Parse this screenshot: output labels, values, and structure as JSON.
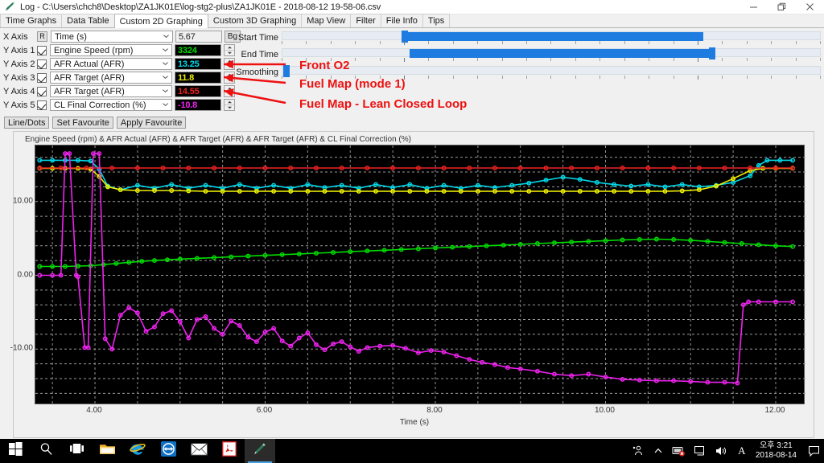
{
  "window": {
    "title": "Log - C:\\Users\\chch8\\Desktop\\ZA1JK01E\\log-stg2-plus\\ZA1JK01E - 2018-08-12 19-58-06.csv",
    "app_icon": "pen-icon",
    "minimize_label": "—",
    "restore_label": "❐",
    "close_label": "✕"
  },
  "tabs": [
    {
      "label": "Time Graphs",
      "active": false
    },
    {
      "label": "Data Table",
      "active": false
    },
    {
      "label": "Custom 2D Graphing",
      "active": true
    },
    {
      "label": "Custom 3D Graphing",
      "active": false
    },
    {
      "label": "Map View",
      "active": false
    },
    {
      "label": "Filter",
      "active": false
    },
    {
      "label": "File Info",
      "active": false
    },
    {
      "label": "Tips",
      "active": false
    }
  ],
  "axes": [
    {
      "label": "X Axis",
      "control": "reset-button",
      "control_label": "R",
      "channel": "Time (s)",
      "value": "5.67",
      "value_color": "#1b1b1b",
      "box_style": "light",
      "extra_button": "Bg"
    },
    {
      "label": "Y Axis 1",
      "control": "checkbox",
      "checked": true,
      "channel": "Engine Speed (rpm)",
      "value": "3324",
      "value_color": "#00dd00",
      "box_style": "dark"
    },
    {
      "label": "Y Axis 2",
      "control": "checkbox",
      "checked": true,
      "channel": "AFR Actual (AFR)",
      "value": "13.25",
      "value_color": "#00d8e8",
      "box_style": "dark"
    },
    {
      "label": "Y Axis 3",
      "control": "checkbox",
      "checked": true,
      "channel": "AFR Target (AFR)",
      "value": "11.8",
      "value_color": "#eeee00",
      "box_style": "dark"
    },
    {
      "label": "Y Axis 4",
      "control": "checkbox",
      "checked": true,
      "channel": "AFR Target (AFR)",
      "value": "14.55",
      "value_color": "#ee2222",
      "box_style": "dark"
    },
    {
      "label": "Y Axis 5",
      "control": "checkbox",
      "checked": true,
      "channel": "CL Final Correction (%)",
      "value": "-10.8",
      "value_color": "#ee22ee",
      "box_style": "dark"
    }
  ],
  "buttons": {
    "line_dots": "Line/Dots",
    "set_favourite": "Set Favourite",
    "apply_favourite": "Apply Favourite"
  },
  "sliders": [
    {
      "name": "Start Time",
      "label": "Start Time",
      "fill_start_pct": 22.5,
      "fill_end_pct": 78.0,
      "thumb_pct": 22.5
    },
    {
      "name": "End Time",
      "label": "End Time",
      "fill_start_pct": 23.6,
      "fill_end_pct": 79.5,
      "thumb_pct": 79.5
    },
    {
      "name": "Smoothing",
      "label": "Smoothing",
      "fill_start_pct": 0,
      "fill_end_pct": 0,
      "thumb_pct": 0.6
    }
  ],
  "annotations": [
    {
      "text": "Front O2",
      "target": "Y Axis 2 spinner"
    },
    {
      "text": "Fuel Map (mode 1)",
      "target": "Y Axis 3 spinner"
    },
    {
      "text": "Fuel Map - Lean Closed Loop",
      "target": "Y Axis 4 spinner"
    }
  ],
  "annotation_color": "#ee1111",
  "chart_data": {
    "type": "line",
    "title": "Engine Speed (rpm) & AFR Actual (AFR) & AFR Target (AFR) & AFR Target (AFR) & CL Final Correction (%)",
    "xlabel": "Time (s)",
    "ylabel": "",
    "xlim": [
      3.3,
      12.35
    ],
    "ylim": [
      -17.6,
      17.6
    ],
    "xticks": [
      "4.00",
      "6.00",
      "8.00",
      "10.00",
      "12.00"
    ],
    "xtick_values": [
      4,
      6,
      8,
      10,
      12
    ],
    "yticks": [
      "10.00",
      "0.00",
      "-10.00"
    ],
    "ytick_values": [
      10,
      0,
      -10
    ],
    "grid": true,
    "background": "#000000",
    "legend": "none",
    "series": [
      {
        "name": "Engine Speed (rpm)",
        "color": "#00dd00",
        "marker": "circle",
        "x": [
          3.35,
          3.5,
          3.65,
          3.8,
          3.95,
          4.1,
          4.25,
          4.4,
          4.55,
          4.7,
          4.85,
          5.0,
          5.2,
          5.4,
          5.6,
          5.8,
          6.0,
          6.2,
          6.4,
          6.6,
          6.8,
          7.0,
          7.2,
          7.4,
          7.6,
          7.8,
          8.0,
          8.2,
          8.4,
          8.6,
          8.8,
          9.0,
          9.2,
          9.4,
          9.6,
          9.8,
          10.0,
          10.2,
          10.4,
          10.6,
          10.8,
          11.0,
          11.2,
          11.4,
          11.6,
          11.8,
          12.0,
          12.2
        ],
        "y": [
          1.2,
          1.2,
          1.2,
          1.25,
          1.3,
          1.45,
          1.6,
          1.75,
          1.9,
          2.0,
          2.1,
          2.2,
          2.3,
          2.4,
          2.5,
          2.6,
          2.7,
          2.8,
          2.9,
          3.0,
          3.1,
          3.2,
          3.3,
          3.4,
          3.5,
          3.6,
          3.7,
          3.8,
          3.9,
          4.0,
          4.1,
          4.2,
          4.3,
          4.4,
          4.5,
          4.6,
          4.7,
          4.8,
          4.85,
          4.9,
          4.85,
          4.75,
          4.6,
          4.45,
          4.3,
          4.15,
          4.0,
          3.9
        ]
      },
      {
        "name": "AFR Actual (AFR)",
        "color": "#00d8e8",
        "marker": "circle",
        "x": [
          3.35,
          3.5,
          3.65,
          3.8,
          3.95,
          4.05,
          4.15,
          4.3,
          4.5,
          4.7,
          4.9,
          5.1,
          5.3,
          5.5,
          5.7,
          5.9,
          6.1,
          6.3,
          6.5,
          6.7,
          6.9,
          7.1,
          7.3,
          7.5,
          7.7,
          7.9,
          8.1,
          8.3,
          8.5,
          8.7,
          8.9,
          9.1,
          9.3,
          9.5,
          9.7,
          9.9,
          10.1,
          10.3,
          10.5,
          10.7,
          10.9,
          11.1,
          11.3,
          11.5,
          11.7,
          11.8,
          11.9,
          12.05,
          12.2
        ],
        "y": [
          15.6,
          15.6,
          15.6,
          15.6,
          15.5,
          14.4,
          12.1,
          11.6,
          12.2,
          11.8,
          12.3,
          11.8,
          12.2,
          11.8,
          12.3,
          11.8,
          12.2,
          11.8,
          12.3,
          11.9,
          12.2,
          11.8,
          12.3,
          11.9,
          12.3,
          11.8,
          12.2,
          11.8,
          12.2,
          11.9,
          12.2,
          12.5,
          12.9,
          13.3,
          13.0,
          12.6,
          12.3,
          12.1,
          12.3,
          12.0,
          12.3,
          12.0,
          12.2,
          12.6,
          13.5,
          14.9,
          15.6,
          15.6,
          15.6
        ]
      },
      {
        "name": "AFR Target (AFR)",
        "color": "#eeee00",
        "marker": "circle",
        "x": [
          3.35,
          3.5,
          3.65,
          3.8,
          3.95,
          4.05,
          4.15,
          4.3,
          4.5,
          4.7,
          4.9,
          5.1,
          5.3,
          5.5,
          5.7,
          5.9,
          6.1,
          6.3,
          6.5,
          6.7,
          6.9,
          7.1,
          7.3,
          7.5,
          7.7,
          7.9,
          8.1,
          8.3,
          8.5,
          8.7,
          8.9,
          9.1,
          9.3,
          9.5,
          9.7,
          9.9,
          10.1,
          10.3,
          10.5,
          10.7,
          10.9,
          11.1,
          11.3,
          11.5,
          11.7,
          11.85,
          12.0,
          12.2
        ],
        "y": [
          14.5,
          14.5,
          14.5,
          14.5,
          14.4,
          13.4,
          12.0,
          11.6,
          11.5,
          11.5,
          11.5,
          11.45,
          11.4,
          11.4,
          11.4,
          11.4,
          11.4,
          11.4,
          11.4,
          11.4,
          11.4,
          11.4,
          11.4,
          11.4,
          11.4,
          11.4,
          11.4,
          11.4,
          11.4,
          11.4,
          11.4,
          11.4,
          11.4,
          11.4,
          11.4,
          11.4,
          11.4,
          11.4,
          11.4,
          11.4,
          11.45,
          11.6,
          12.1,
          13.1,
          14.2,
          14.5,
          14.5,
          14.5
        ]
      },
      {
        "name": "AFR Target (AFR) 2",
        "color": "#ee2222",
        "marker": "circle",
        "x": [
          3.35,
          3.6,
          3.9,
          4.2,
          4.5,
          4.8,
          5.1,
          5.4,
          5.7,
          6.0,
          6.3,
          6.6,
          6.9,
          7.2,
          7.5,
          7.8,
          8.1,
          8.4,
          8.7,
          9.0,
          9.3,
          9.6,
          9.9,
          10.2,
          10.5,
          10.8,
          11.1,
          11.4,
          11.7,
          12.0,
          12.2
        ],
        "y": [
          14.55,
          14.55,
          14.55,
          14.55,
          14.55,
          14.55,
          14.55,
          14.55,
          14.55,
          14.55,
          14.55,
          14.55,
          14.55,
          14.55,
          14.55,
          14.55,
          14.55,
          14.55,
          14.55,
          14.55,
          14.55,
          14.55,
          14.55,
          14.55,
          14.55,
          14.55,
          14.55,
          14.55,
          14.55,
          14.55,
          14.55
        ]
      },
      {
        "name": "CL Final Correction (%)",
        "color": "#ee22ee",
        "marker": "circle",
        "x": [
          3.35,
          3.5,
          3.6,
          3.65,
          3.7,
          3.78,
          3.8,
          3.88,
          3.92,
          3.98,
          4.05,
          4.12,
          4.2,
          4.3,
          4.4,
          4.5,
          4.6,
          4.7,
          4.8,
          4.9,
          5.0,
          5.1,
          5.2,
          5.3,
          5.4,
          5.5,
          5.6,
          5.7,
          5.8,
          5.9,
          6.0,
          6.1,
          6.2,
          6.3,
          6.4,
          6.5,
          6.6,
          6.7,
          6.8,
          6.9,
          7.0,
          7.1,
          7.2,
          7.35,
          7.5,
          7.65,
          7.8,
          7.95,
          8.1,
          8.25,
          8.4,
          8.55,
          8.7,
          8.85,
          9.0,
          9.2,
          9.4,
          9.6,
          9.8,
          10.0,
          10.2,
          10.4,
          10.6,
          10.8,
          11.0,
          11.2,
          11.4,
          11.55,
          11.62,
          11.68,
          11.8,
          12.0,
          12.2
        ],
        "y": [
          0,
          0,
          0,
          16.5,
          16.5,
          0,
          -0.2,
          -9.8,
          -9.8,
          16.5,
          16.5,
          -8.6,
          -10.0,
          -5.4,
          -4.4,
          -5.1,
          -7.6,
          -7.0,
          -5.2,
          -4.8,
          -6.3,
          -8.5,
          -6.0,
          -5.6,
          -7.2,
          -8.0,
          -6.2,
          -6.8,
          -8.4,
          -9.0,
          -7.7,
          -7.2,
          -8.9,
          -9.6,
          -8.5,
          -7.8,
          -9.4,
          -10.1,
          -9.3,
          -9.0,
          -9.7,
          -10.3,
          -9.8,
          -9.6,
          -9.5,
          -9.9,
          -10.5,
          -10.2,
          -10.4,
          -10.9,
          -11.4,
          -11.8,
          -12.1,
          -12.5,
          -12.7,
          -13.0,
          -13.4,
          -13.6,
          -13.4,
          -13.8,
          -14.1,
          -14.2,
          -14.3,
          -14.3,
          -14.4,
          -14.5,
          -14.5,
          -14.6,
          -4.0,
          -3.6,
          -3.6,
          -3.6,
          -3.6
        ]
      }
    ]
  },
  "taskbar": {
    "items": [
      {
        "name": "start-button",
        "icon": "windows-icon"
      },
      {
        "name": "search-button",
        "icon": "search-icon"
      },
      {
        "name": "task-view-button",
        "icon": "task-view-icon"
      },
      {
        "name": "file-explorer-button",
        "icon": "folder-icon"
      },
      {
        "name": "internet-explorer-button",
        "icon": "internet-explorer-icon"
      },
      {
        "name": "teamviewer-button",
        "icon": "teamviewer-icon"
      },
      {
        "name": "mail-button",
        "icon": "mail-icon"
      },
      {
        "name": "pdf-reader-button",
        "icon": "pdf-icon"
      },
      {
        "name": "log-viewer-button",
        "icon": "pen-icon"
      }
    ],
    "tray": {
      "icons": [
        "people-icon",
        "show-hidden-icons-chevron",
        "network-error-icon",
        "display-icon",
        "volume-icon",
        "ime-indicator"
      ],
      "ime_label": "A",
      "time": "오후 3:21",
      "date": "2018-08-14",
      "action_center": "action-center-icon"
    }
  }
}
